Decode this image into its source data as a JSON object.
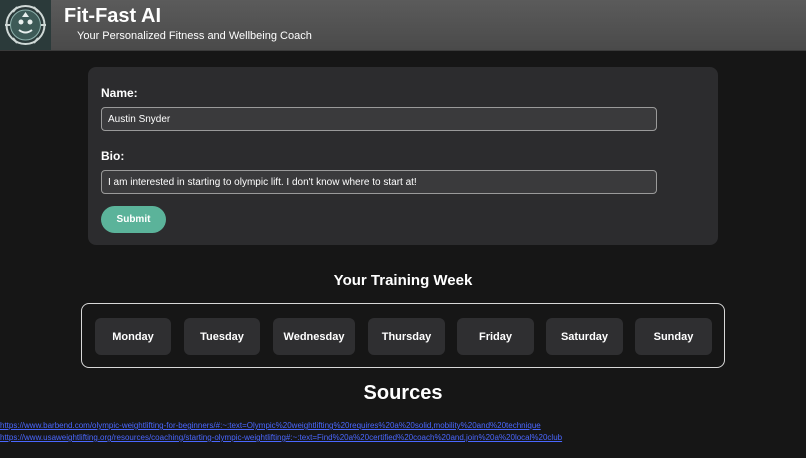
{
  "header": {
    "title": "Fit-Fast AI",
    "subtitle": "Your Personalized Fitness and Wellbeing Coach",
    "logo_icon": "emblem-logo-icon"
  },
  "form": {
    "name_label": "Name:",
    "name_value": "Austin Snyder",
    "bio_label": "Bio:",
    "bio_value": "I am interested in starting to olympic lift. I don't know where to start at!",
    "submit_label": "Submit"
  },
  "week": {
    "heading": "Your Training Week",
    "days": [
      "Monday",
      "Tuesday",
      "Wednesday",
      "Thursday",
      "Friday",
      "Saturday",
      "Sunday"
    ]
  },
  "sources": {
    "heading": "Sources",
    "links": [
      "https://www.barbend.com/olympic-weightlifting-for-beginners/#:~:text=Olympic%20weightlifting%20requires%20a%20solid,mobility%20and%20technique",
      "https://www.usaweightlifting.org/resources/coaching/starting-olympic-weightlifting#:~:text=Find%20a%20certified%20coach%20and,join%20a%20local%20club"
    ]
  },
  "colors": {
    "background": "#161616",
    "header": "#4f4f4f",
    "card": "#2c2c2e",
    "accent": "#5bb39a",
    "link": "#4a67ff"
  }
}
